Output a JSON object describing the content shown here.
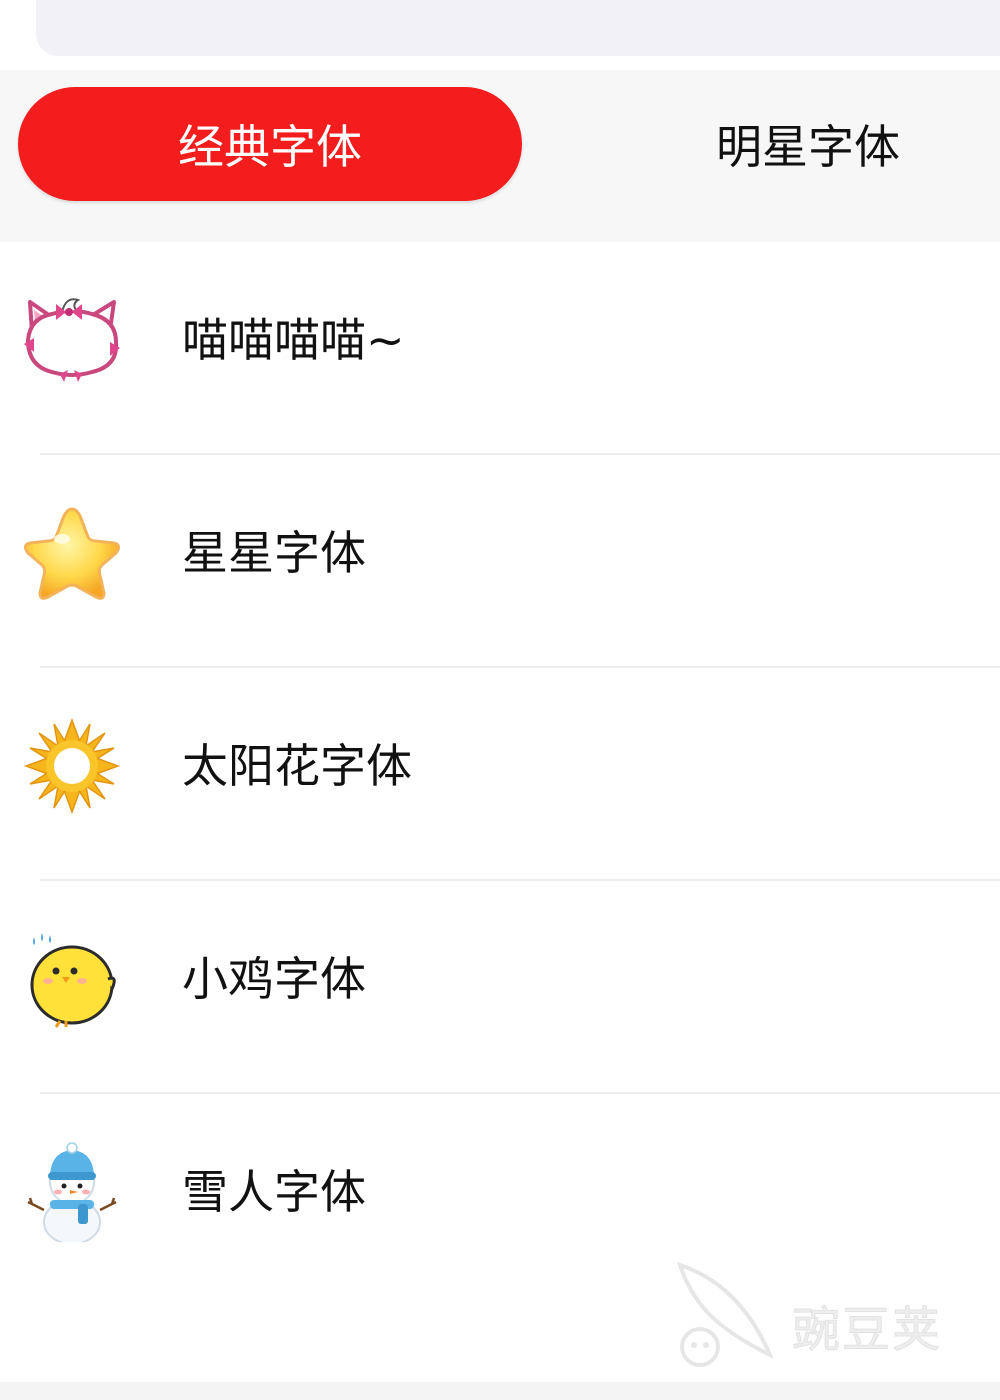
{
  "tabs": [
    {
      "label": "经典字体",
      "active": true
    },
    {
      "label": "明星字体",
      "active": false
    }
  ],
  "colors": {
    "accent": "#f31d1d",
    "tab_bar_bg": "#f7f7f7",
    "divider": "#ececec"
  },
  "font_list": [
    {
      "label": "喵喵喵喵~",
      "icon": "cat-face-icon"
    },
    {
      "label": "星星字体",
      "icon": "star-icon"
    },
    {
      "label": "太阳花字体",
      "icon": "sunflower-icon"
    },
    {
      "label": "小鸡字体",
      "icon": "chick-icon"
    },
    {
      "label": "雪人字体",
      "icon": "snowman-icon"
    }
  ],
  "watermark": {
    "text": "豌豆荚",
    "icon": "pea-pod-icon"
  }
}
